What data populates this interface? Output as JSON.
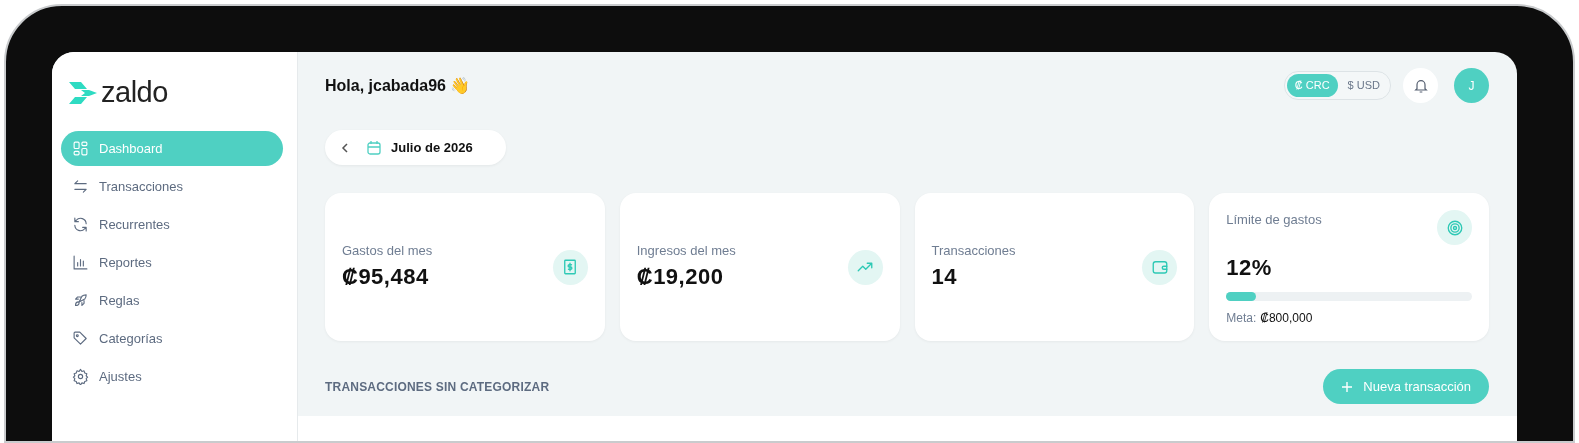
{
  "brand": "zaldo",
  "nav": [
    {
      "label": "Dashboard",
      "selected": true
    },
    {
      "label": "Transacciones",
      "selected": false
    },
    {
      "label": "Recurrentes",
      "selected": false
    },
    {
      "label": "Reportes",
      "selected": false
    },
    {
      "label": "Reglas",
      "selected": false
    },
    {
      "label": "Categorías",
      "selected": false
    },
    {
      "label": "Ajustes",
      "selected": false
    }
  ],
  "greeting": "Hola, jcabada96 👋",
  "currency": [
    {
      "label": "₡ CRC",
      "selected": true
    },
    {
      "label": "$ USD",
      "selected": false
    }
  ],
  "avatar": "J",
  "period": "Julio de 2026",
  "stats": [
    {
      "kind": "expense",
      "label": "Gastos del mes",
      "value": "₡95,484"
    },
    {
      "kind": "income",
      "label": "Ingresos del mes",
      "value": "₡19,200"
    },
    {
      "kind": "count",
      "label": "Transacciones",
      "value": "14"
    },
    {
      "kind": "limit",
      "label": "Límite de gastos",
      "value": "12%",
      "level": 0.12,
      "meta_label": "Meta:",
      "meta_value": "₡800,000"
    }
  ],
  "section_title": "TRANSACCIONES SIN CATEGORIZAR",
  "new_button": "Nueva transacción"
}
